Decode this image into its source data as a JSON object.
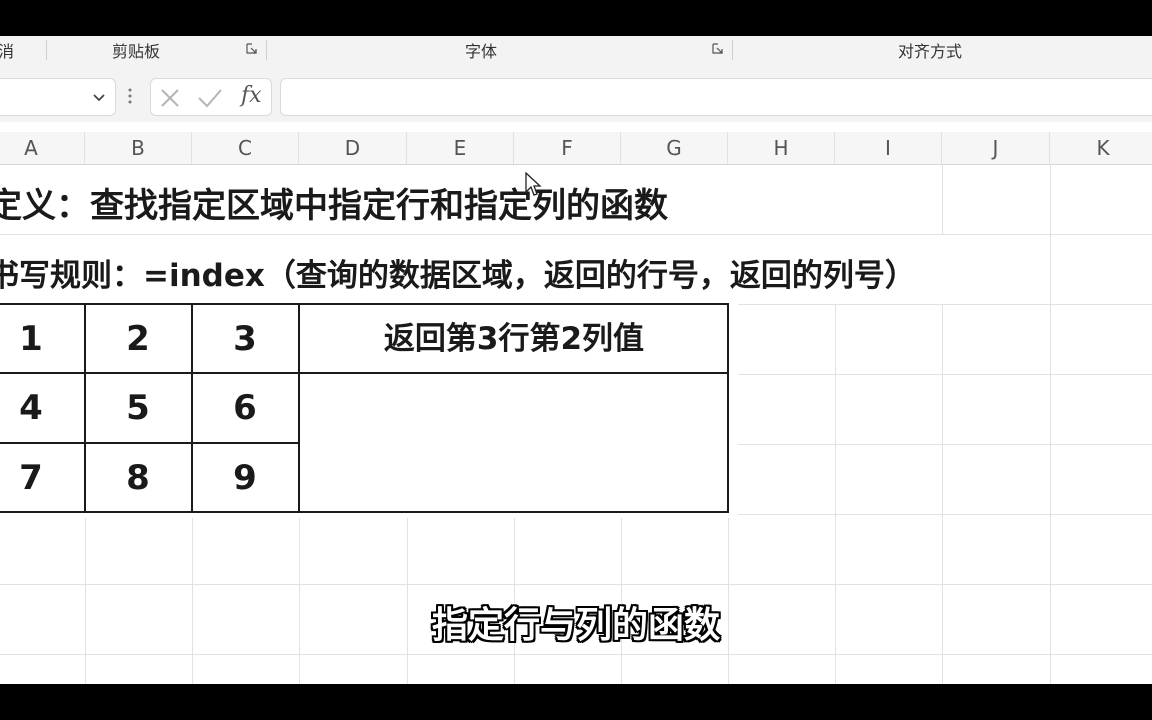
{
  "ribbon": {
    "groups": [
      "消",
      "剪贴板",
      "字体",
      "对齐方式"
    ]
  },
  "formula_bar": {
    "name_box_value": "",
    "fx_label": "fx",
    "formula_value": ""
  },
  "columns": [
    "A",
    "B",
    "C",
    "D",
    "E",
    "F",
    "G",
    "H",
    "I",
    "J",
    "K"
  ],
  "sheet": {
    "definition": "定义：查找指定区域中指定行和指定列的函数",
    "syntax": "书写规则：=index（查询的数据区域，返回的行号，返回的列号）",
    "table": [
      [
        "1",
        "2",
        "3"
      ],
      [
        "4",
        "5",
        "6"
      ],
      [
        "7",
        "8",
        "9"
      ]
    ],
    "note": "返回第3行第2列值"
  },
  "subtitle": "指定行与列的函数",
  "icons": {
    "dialog_launcher": "dialog-launcher-icon",
    "dropdown": "chevron-down-icon",
    "cancel": "cancel-x-icon",
    "enter": "checkmark-icon",
    "insert_function": "fx-icon",
    "cursor": "mouse-pointer-icon"
  }
}
